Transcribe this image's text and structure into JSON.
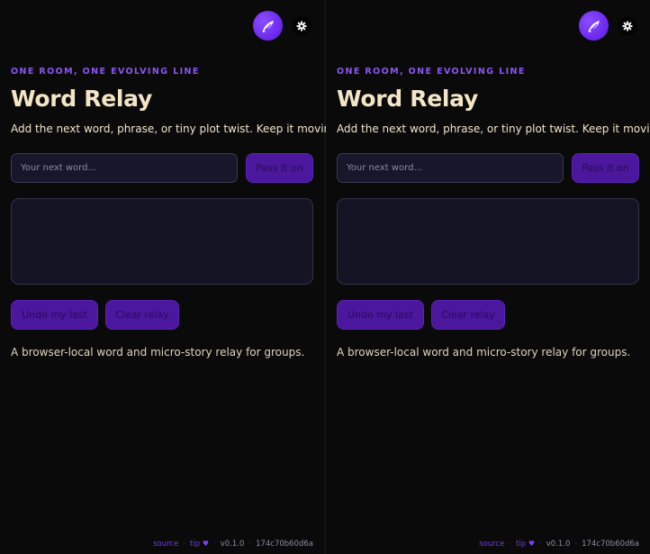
{
  "panes": [
    {
      "eyebrow": "ONE ROOM, ONE EVOLVING LINE",
      "title": "Word Relay",
      "subtitle": "Add the next word, phrase, or tiny plot twist. Keep it moving.",
      "input_placeholder": "Your next word...",
      "pass_label": "Pass it on",
      "undo_label": "Undo my last",
      "clear_label": "Clear relay",
      "footnote": "A browser-local word and micro-story relay for groups.",
      "footer": {
        "source": "source",
        "tip": "tip",
        "version": "v0.1.0",
        "hash": "174c70b60d6a"
      }
    },
    {
      "eyebrow": "ONE ROOM, ONE EVOLVING LINE",
      "title": "Word Relay",
      "subtitle": "Add the next word, phrase, or tiny plot twist. Keep it moving.",
      "input_placeholder": "Your next word...",
      "pass_label": "Pass it on",
      "undo_label": "Undo my last",
      "clear_label": "Clear relay",
      "footnote": "A browser-local word and micro-story relay for groups.",
      "footer": {
        "source": "source",
        "tip": "tip",
        "version": "v0.1.0",
        "hash": "174c70b60d6a"
      }
    }
  ],
  "icons": {
    "avatar": "feather-icon",
    "settings": "gear-icon",
    "tip": "heart-icon"
  },
  "colors": {
    "background": "#0b0a0b",
    "accent": "#6f2bf0",
    "title": "#f3e6c6",
    "eyebrow": "#8a55f0",
    "button_bg": "#4b179c"
  }
}
